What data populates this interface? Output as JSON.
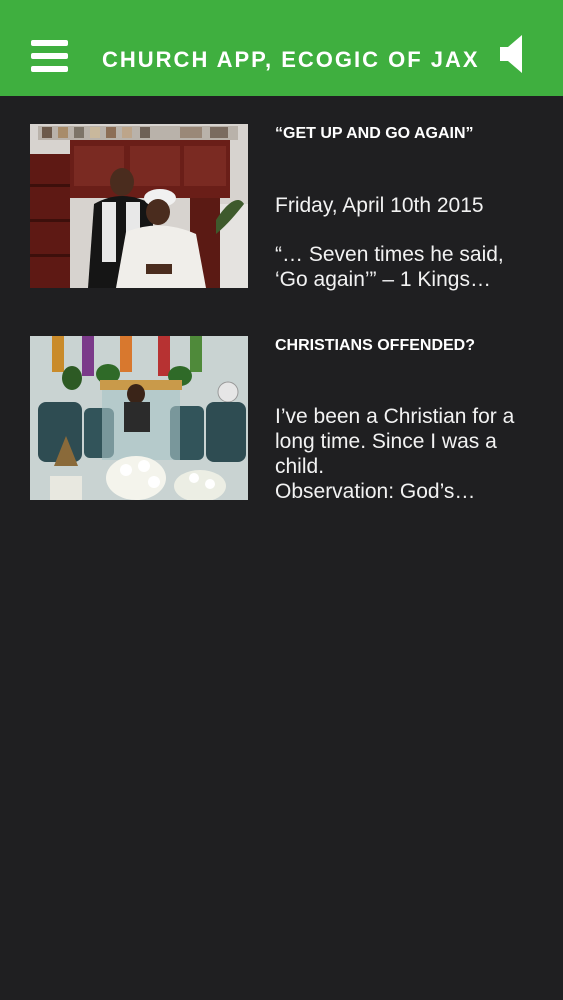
{
  "header": {
    "title": "CHURCH APP, ECOGIC OF JAX",
    "menu_icon": "hamburger-menu-icon",
    "sound_icon": "speaker-icon"
  },
  "colors": {
    "header_bg": "#3faf3f",
    "background": "#1f1f21",
    "text": "#ffffff"
  },
  "posts": [
    {
      "title": "“GET UP AND GO AGAIN”",
      "date": "Friday, April 10th 2015",
      "excerpt": "“… Seven times he said,\n‘Go again’” – 1 Kings…"
    },
    {
      "title": "CHRISTIANS OFFENDED?",
      "date": "",
      "excerpt": "I’ve been a Christian for a\nlong time. Since I was a\nchild.\nObservation: God’s…"
    }
  ]
}
